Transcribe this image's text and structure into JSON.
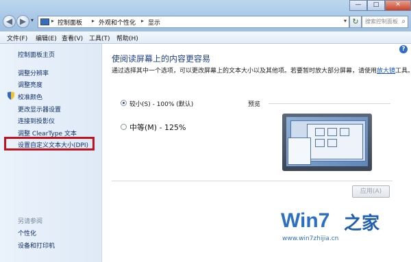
{
  "window": {
    "buttons": {
      "minimize": "—",
      "maximize": "□",
      "close": "✕"
    },
    "nav": {
      "back_icon": "back-arrow-icon",
      "forward_icon": "forward-arrow-icon"
    }
  },
  "address": {
    "segments": [
      "控制面板",
      "外观和个性化",
      "显示"
    ],
    "search_placeholder": "搜索控制面板"
  },
  "menu": [
    "文件(F)",
    "编辑(E)",
    "查看(V)",
    "工具(T)",
    "帮助(H)"
  ],
  "sidebar": {
    "items": [
      "控制面板主页",
      "调整分辨率",
      "调整亮度",
      "校准颜色",
      "更改显示器设置",
      "连接到投影仪",
      "调整 ClearType 文本",
      "设置自定义文本大小(DPI)"
    ],
    "see_also": "另请参阅",
    "see_also_items": [
      "个性化",
      "设备和打印机"
    ]
  },
  "main": {
    "title": "使阅读屏幕上的内容更容易",
    "desc_before": "通过选择其中一个选项，可以更改屏幕上的文本大小以及其他项。若要暂时放大部分屏幕，请使用",
    "desc_link": "放大镜",
    "desc_after": "工具。",
    "options": [
      {
        "label": "较小(S) - 100% (默认)",
        "selected": true
      },
      {
        "label": "中等(M) - 125%",
        "selected": false
      }
    ],
    "preview_label": "预览",
    "apply_label": "应用(A)"
  },
  "watermark": {
    "brand": "Win7",
    "brand_mark": "之家",
    "url": "www.win7zhijia.cn"
  },
  "colors": {
    "highlight": "#c1121f",
    "link": "#0f2f66",
    "heading": "#1e3f8f"
  }
}
